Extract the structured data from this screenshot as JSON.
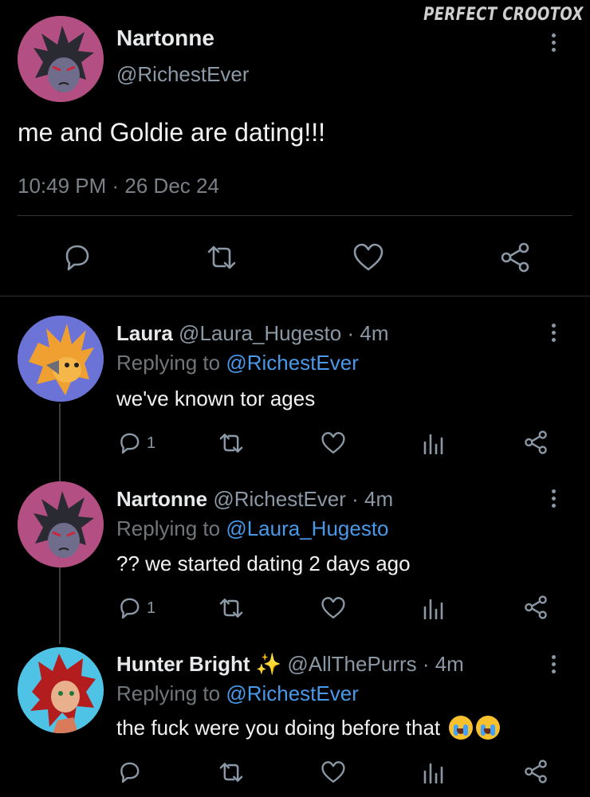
{
  "watermark": "PERFECT CROOTOX",
  "main_post": {
    "name": "Nartonne",
    "handle": "@RichestEver",
    "text": "me and Goldie are dating!!!",
    "timestamp": "10:49 PM · 26 Dec 24",
    "actions": [
      "reply-icon",
      "retweet-icon",
      "like-icon",
      "share-icon"
    ]
  },
  "replies": [
    {
      "name": "Laura",
      "handle": "@Laura_Hugesto",
      "time": "· 4m",
      "replying_prefix": "Replying to ",
      "replying_to": "@RichestEver",
      "text": "we've known tor ages",
      "reply_count": "1"
    },
    {
      "name": "Nartonne",
      "handle": "@RichestEver",
      "time": "· 4m",
      "replying_prefix": "Replying to ",
      "replying_to": "@Laura_Hugesto",
      "text": "?? we started dating 2 days ago",
      "reply_count": "1"
    },
    {
      "name": "Hunter Bright",
      "sparkle": "✨",
      "handle": "@AllThePurrs",
      "time": "· 4m",
      "replying_prefix": "Replying to ",
      "replying_to": "@RichestEver",
      "text": "the fuck were you doing before that",
      "emoji_name": "loudly-crying-face-emoji",
      "reply_count": ""
    }
  ],
  "colors": {
    "background": "#000000",
    "text": "#e7e9ea",
    "muted": "#71767b",
    "link": "#4a99e9",
    "divider": "#2f3336"
  }
}
